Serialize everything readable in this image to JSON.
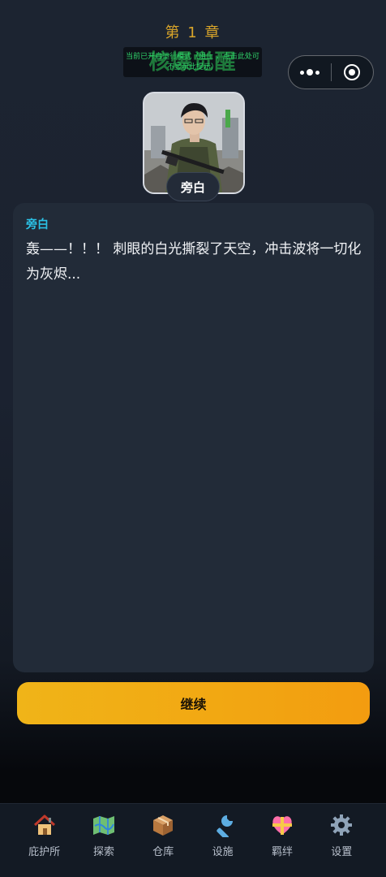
{
  "header": {
    "chapter": "第 1 章",
    "title": "核爆觉醒",
    "title_overlay": "当前已开启运行模式（阻止 ，点击此处可不显示此提示）"
  },
  "capsule": {
    "more_icon": "more-dots-icon",
    "close_icon": "target-close-icon"
  },
  "avatar": {
    "tag": "旁白"
  },
  "dialog": {
    "speaker": "旁白",
    "text": "轰——！！！ 刺眼的白光撕裂了天空，冲击波将一切化为灰烬..."
  },
  "continue_label": "继续",
  "tabs": [
    {
      "icon": "house-icon",
      "label": "庇护所"
    },
    {
      "icon": "map-icon",
      "label": "探索"
    },
    {
      "icon": "box-icon",
      "label": "仓库"
    },
    {
      "icon": "wrench-icon",
      "label": "设施"
    },
    {
      "icon": "heart-icon",
      "label": "羁绊"
    },
    {
      "icon": "gear-icon",
      "label": "设置"
    }
  ],
  "colors": {
    "chapter": "#d9a52a",
    "speaker": "#2bc0e4",
    "button": "#f2a712"
  }
}
